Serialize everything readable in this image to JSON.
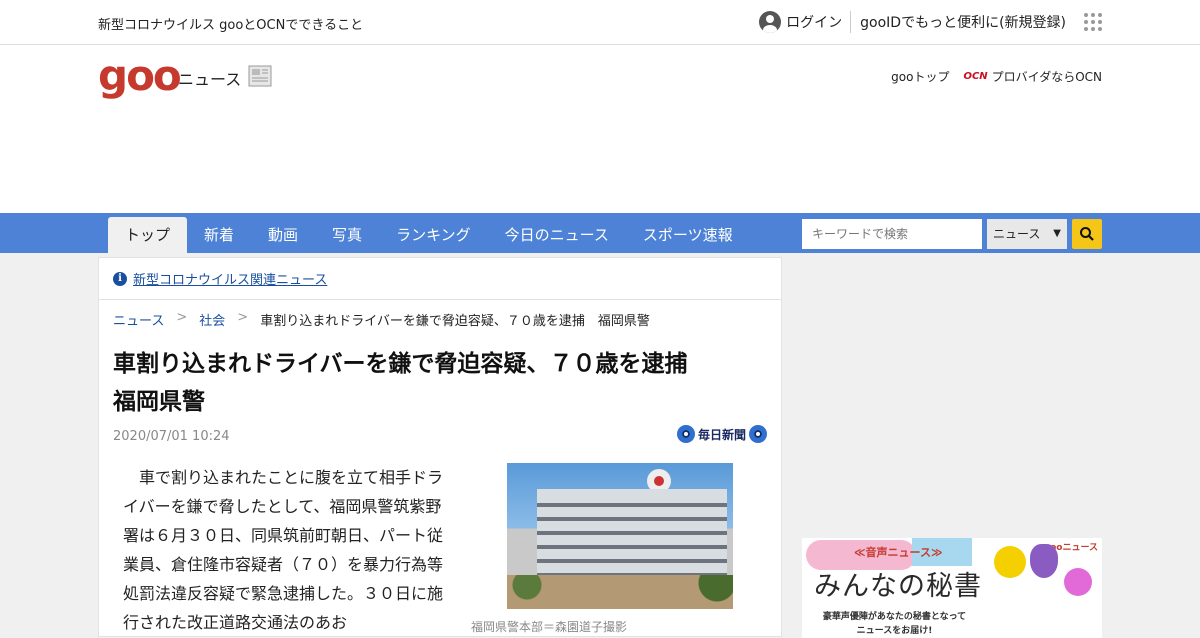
{
  "util_bar": {
    "covid_link": "新型コロナウイルス gooとOCNでできること",
    "login": "ログイン",
    "register": "gooIDでもっと便利に(新規登録)"
  },
  "header": {
    "logo": "goo",
    "logo_sub": "ニュース",
    "goo_top": "gooトップ",
    "ocn_logo": "OCN",
    "ocn_text": "プロバイダならOCN"
  },
  "nav": {
    "items": [
      "トップ",
      "新着",
      "動画",
      "写真",
      "ランキング",
      "今日のニュース",
      "スポーツ速報"
    ],
    "search_placeholder": "キーワードで検索",
    "select_value": "ニュース"
  },
  "alert": {
    "text": "新型コロナウイルス関連ニュース"
  },
  "breadcrumb": {
    "items": [
      "ニュース",
      "社会",
      "車割り込まれドライバーを鎌で脅迫容疑、７０歳を逮捕　福岡県警"
    ],
    "separator": ">"
  },
  "article": {
    "title": "車割り込まれドライバーを鎌で脅迫容疑、７０歳を逮捕　福岡県警",
    "date": "2020/07/01 10:24",
    "source": "毎日新聞",
    "body": "車で割り込まれたことに腹を立て相手ドライバーを鎌で脅したとして、福岡県警筑紫野署は６月３０日、同県筑前町朝日、パート従業員、倉住隆市容疑者（７０）を暴力行為等処罰法違反容疑で緊急逮捕した。３０日に施行された改正道路交通法のあお",
    "photo_caption": "福岡県警本部＝森園道子撮影"
  },
  "sidebar_ad": {
    "tag": "≪音声ニュース≫",
    "headline": "みんなの秘書",
    "sub1": "豪華声優陣があなたの秘書となって",
    "sub2": "ニュースをお届け!",
    "brand": "gooニュース"
  },
  "colors": {
    "nav_bg": "#4d82d6",
    "logo": "#c63a2e",
    "link": "#1a4fa0",
    "search_button": "#f5c518"
  }
}
